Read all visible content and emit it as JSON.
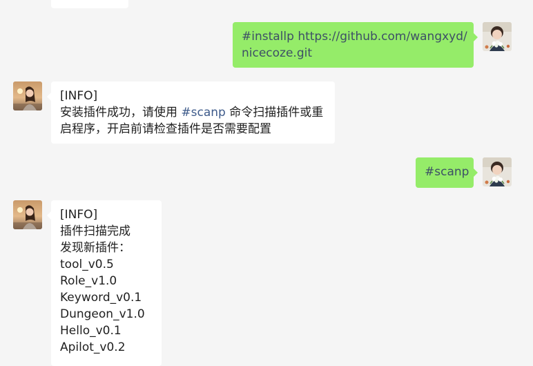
{
  "chat": {
    "messages": [
      {
        "side": "out",
        "avatar": "user-avatar",
        "lines": [
          "#installp https://github.com/wangxyd/",
          "nicecoze.git"
        ]
      },
      {
        "side": "in",
        "avatar": "bot-avatar",
        "lines": [
          "[INFO]",
          "安装插件成功，请使用 ",
          "#scanp",
          " 命令扫描插件或重",
          "启程序，开启前请检查插件是否需要配置"
        ]
      },
      {
        "side": "out",
        "avatar": "user-avatar",
        "lines": [
          "#scanp"
        ]
      },
      {
        "side": "in",
        "avatar": "bot-avatar",
        "lines": [
          "[INFO]",
          "插件扫描完成",
          "发现新插件：",
          "tool_v0.5",
          "Role_v1.0",
          "Keyword_v0.1",
          "Dungeon_v1.0",
          "Hello_v0.1",
          "Apilot_v0.2"
        ]
      }
    ]
  },
  "colors": {
    "background": "#f5f5f5",
    "incoming_bubble": "#ffffff",
    "outgoing_bubble": "#95ec69",
    "hashtag": "#3d5a8a"
  }
}
